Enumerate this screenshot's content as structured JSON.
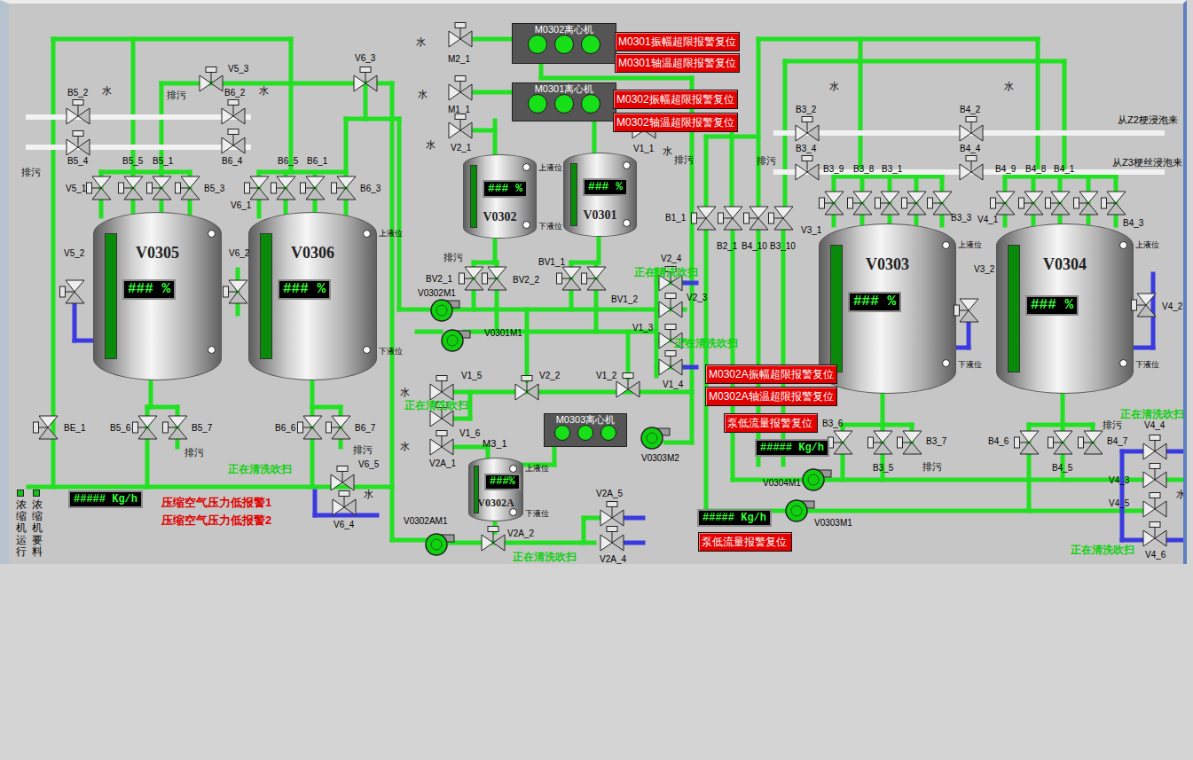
{
  "tanks": [
    {
      "name": "V0305",
      "reading": "###  %",
      "level": 1.0
    },
    {
      "name": "V0306",
      "reading": "###  %",
      "level": 1.0,
      "high_label": "上液位",
      "low_label": "下液位"
    },
    {
      "name": "V0302",
      "reading": "### %",
      "level": 1.0,
      "high_label": "上液位",
      "low_label": "下液位"
    },
    {
      "name": "V0301",
      "reading": "### %",
      "level": 1.0
    },
    {
      "name": "V0302A",
      "reading": "###%",
      "level": 1.0,
      "high_label": "上液位",
      "low_label": "下液位"
    },
    {
      "name": "V0303",
      "reading": "### %",
      "level": 1.0,
      "high_label": "上液位",
      "low_label": "下液位"
    },
    {
      "name": "V0304",
      "reading": "###  %",
      "level": 1.0,
      "high_label": "上液位",
      "low_label": "下液位"
    }
  ],
  "valves": [
    {
      "label": "B5_2"
    },
    {
      "label": "B5_4"
    },
    {
      "label": "B6_2"
    },
    {
      "label": "B6_4"
    },
    {
      "label": "V5_3"
    },
    {
      "label": "V6_3"
    },
    {
      "label": "V5_1"
    },
    {
      "label": "B5_5"
    },
    {
      "label": "B5_1"
    },
    {
      "label": "B5_3"
    },
    {
      "label": "V6_1"
    },
    {
      "label": "B6_5"
    },
    {
      "label": "B6_1"
    },
    {
      "label": "B6_3"
    },
    {
      "label": "V5_2"
    },
    {
      "label": "V6_2"
    },
    {
      "label": "BE_1"
    },
    {
      "label": "B5_6"
    },
    {
      "label": "B5_7"
    },
    {
      "label": "B6_6"
    },
    {
      "label": "B6_7"
    },
    {
      "label": "V6_5"
    },
    {
      "label": "V6_4"
    },
    {
      "label": "M2_1"
    },
    {
      "label": "M1_1"
    },
    {
      "label": "V2_1"
    },
    {
      "label": "V1_1"
    },
    {
      "label": "BV2_1"
    },
    {
      "label": "BV2_2"
    },
    {
      "label": "BV1_1"
    },
    {
      "label": "BV1_2"
    },
    {
      "label": "V2_4"
    },
    {
      "label": "V2_3"
    },
    {
      "label": "V1_3"
    },
    {
      "label": "V1_4"
    },
    {
      "label": "V1_5"
    },
    {
      "label": "V1_6"
    },
    {
      "label": "V2_2"
    },
    {
      "label": "V1_2"
    },
    {
      "label": "V2A_1"
    },
    {
      "label": "V2A_2"
    },
    {
      "label": "V2A_5"
    },
    {
      "label": "V2A_4"
    },
    {
      "label": "B1_1"
    },
    {
      "label": "B2_1"
    },
    {
      "label": "B4_10"
    },
    {
      "label": "B3_10"
    },
    {
      "label": "B3_2"
    },
    {
      "label": "B3_4"
    },
    {
      "label": "B4_2"
    },
    {
      "label": "B4_4"
    },
    {
      "label": "B3_9"
    },
    {
      "label": "B3_8"
    },
    {
      "label": "B3_1"
    },
    {
      "label": "V3_1"
    },
    {
      "label": "B3_3"
    },
    {
      "label": "B4_9"
    },
    {
      "label": "B4_8"
    },
    {
      "label": "B4_1"
    },
    {
      "label": "V4_1"
    },
    {
      "label": "B4_3"
    },
    {
      "label": "V3_2"
    },
    {
      "label": "V4_2"
    },
    {
      "label": "B3_6"
    },
    {
      "label": "B3_5"
    },
    {
      "label": "B3_7"
    },
    {
      "label": "B4_6"
    },
    {
      "label": "B4_5"
    },
    {
      "label": "B4_7"
    },
    {
      "label": "V4_4"
    },
    {
      "label": "V4_3"
    },
    {
      "label": "V4_5"
    },
    {
      "label": "V4_6"
    }
  ],
  "centrifuges": [
    {
      "name": "M0302离心机",
      "lights": [
        {
          "on": true
        },
        {
          "on": true
        },
        {
          "on": true
        }
      ]
    },
    {
      "name": "M0301离心机",
      "lights": [
        {
          "on": true
        },
        {
          "on": true
        },
        {
          "on": true
        }
      ]
    },
    {
      "name": "M0303离心机",
      "lights": [
        {
          "on": true
        },
        {
          "on": true
        },
        {
          "on": true
        }
      ]
    }
  ],
  "pumps": [
    {
      "label": "V0302M1",
      "running": true
    },
    {
      "label": "V0301M1",
      "running": true
    },
    {
      "label": "V0303M2",
      "running": true
    },
    {
      "label": "V0304M1",
      "running": true
    },
    {
      "label": "V0303M1",
      "running": true
    },
    {
      "label": "V0302AM1",
      "running": true
    }
  ],
  "alarm_buttons": [
    {
      "label": "M0301振幅超限报警复位"
    },
    {
      "label": "M0301轴温超限报警复位"
    },
    {
      "label": "M0302振幅超限报警复位"
    },
    {
      "label": "M0302轴温超限报警复位"
    },
    {
      "label": "M0302A振幅超限报警复位"
    },
    {
      "label": "M0302A轴温超限报警复位"
    },
    {
      "label": "泵低流量报警复位"
    },
    {
      "label": "泵低流量报警复位"
    }
  ],
  "flow_displays": [
    {
      "value": "##### Kg/h"
    },
    {
      "value": "##### Kg/h"
    },
    {
      "value": "##### Kg/h"
    }
  ],
  "alarms": [
    {
      "text": "压缩空气压力低报警1"
    },
    {
      "text": "压缩空气压力低报警2"
    }
  ],
  "status_texts": [
    {
      "text": "正在清洗吹扫"
    },
    {
      "text": "正在清洗吹扫"
    },
    {
      "text": "正在清洗吹扫"
    },
    {
      "text": "正在清洗吹扫"
    },
    {
      "text": "正在清洗吹扫"
    },
    {
      "text": "正在清洗吹扫"
    },
    {
      "text": "正在清洗吹扫"
    }
  ],
  "labels": [
    {
      "text": "水"
    },
    {
      "text": "水"
    },
    {
      "text": "排污"
    },
    {
      "text": "排污"
    },
    {
      "text": "排污"
    },
    {
      "text": "排污"
    },
    {
      "text": "水"
    },
    {
      "text": "水"
    },
    {
      "text": "水"
    },
    {
      "text": "水"
    },
    {
      "text": "水"
    },
    {
      "text": "排污"
    },
    {
      "text": "排污"
    },
    {
      "text": "水"
    },
    {
      "text": "水"
    },
    {
      "text": "M3_1"
    },
    {
      "text": "水"
    },
    {
      "text": "水"
    },
    {
      "text": "排污"
    },
    {
      "text": "从Z2梗浸泡来"
    },
    {
      "text": "从Z3梗丝浸泡来"
    },
    {
      "text": "排污"
    },
    {
      "text": "排污"
    },
    {
      "text": "水"
    }
  ],
  "indicators": [
    {
      "label": "浓缩机运行",
      "on": true
    },
    {
      "label": "浓缩机要料",
      "on": true
    }
  ]
}
